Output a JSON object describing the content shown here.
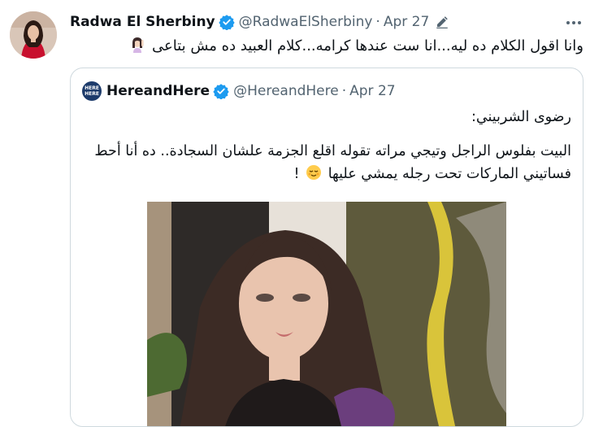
{
  "tweet": {
    "author_name": "Radwa El Sherbiny",
    "author_handle": "@RadwaElSherbiny",
    "separator": "·",
    "date": "Apr 27",
    "text": "وانا اقول الكلام ده ليه...انا ست عندها كرامه...كلام العبيد ده مش بتاعى",
    "text_emoji": "woman-raising-hand-emoji",
    "verified": true,
    "edited_icon": "pencil-icon",
    "more_icon": "more-horizontal-icon"
  },
  "quoted_tweet": {
    "author_name": "HereandHere",
    "author_handle": "@HereandHere",
    "separator": "·",
    "date": "Apr 27",
    "avatar_lines": [
      "HERE",
      "HERE"
    ],
    "verified": true,
    "lines": [
      "رضوى الشربيني:",
      "البيت بفلوس الراجل وتيجي مراته تقوله اقلع الجزمة علشان السجادة.. ده أنا أحط",
      "فساتيني الماركات تحت رجله يمشي عليها"
    ],
    "line3_suffix": "!",
    "line3_emoji": "relieved-face-emoji",
    "image": "portrait-photo"
  },
  "colors": {
    "verified_blue": "#1d9bf0",
    "secondary_text": "#536471",
    "border": "#cfd9de"
  }
}
